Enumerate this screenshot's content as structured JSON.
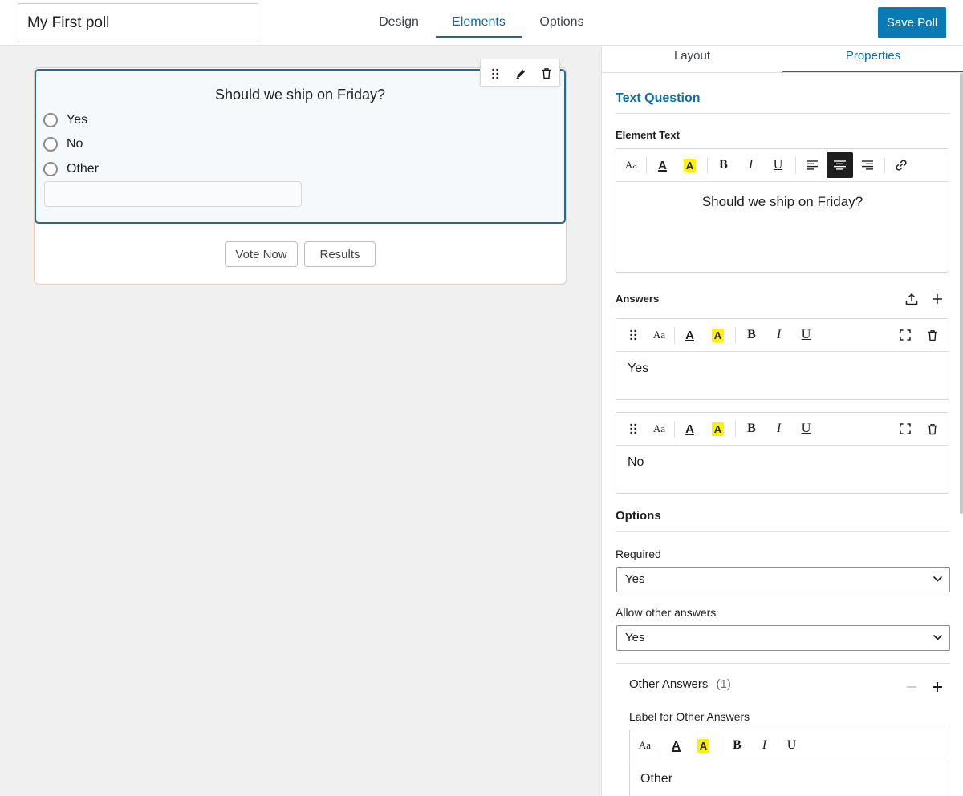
{
  "header": {
    "poll_title": "My First poll",
    "tabs": [
      {
        "label": "Design"
      },
      {
        "label": "Elements"
      },
      {
        "label": "Options"
      }
    ],
    "active_tab": "Elements",
    "save_label": "Save Poll"
  },
  "preview": {
    "question": "Should we ship on Friday?",
    "answers": [
      "Yes",
      "No",
      "Other"
    ],
    "buttons": {
      "vote": "Vote Now",
      "results": "Results"
    }
  },
  "panel": {
    "tabs": [
      {
        "label": "Layout"
      },
      {
        "label": "Properties"
      }
    ],
    "active_tab": "Properties",
    "section_title": "Text Question",
    "element_text_label": "Element Text",
    "element_text": "Should we ship on Friday?",
    "answers_label": "Answers",
    "answers": [
      "Yes",
      "No"
    ],
    "options_heading": "Options",
    "required_label": "Required",
    "required_value": "Yes",
    "allow_other_label": "Allow other answers",
    "allow_other_value": "Yes",
    "other_answers_label": "Other Answers",
    "other_answers_count": "(1)",
    "label_other_label": "Label for Other Answers",
    "label_other_value": "Other",
    "format_aa": "Aa",
    "format_a": "A",
    "format_b": "B",
    "format_i": "I",
    "format_u": "U"
  },
  "colors": {
    "accent": "#0a6fa8",
    "save_button": "#0a7ab5",
    "highlight": "#fff200"
  }
}
